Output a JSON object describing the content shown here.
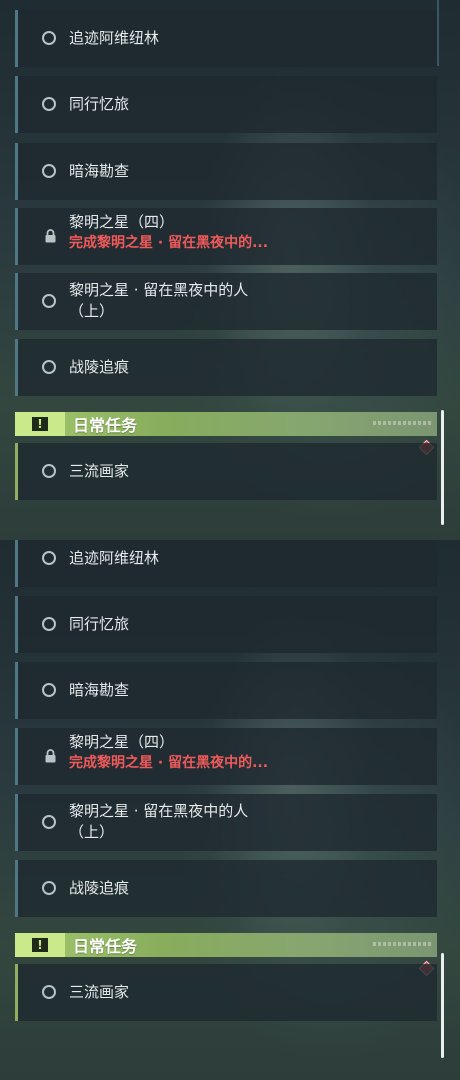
{
  "quests": [
    {
      "title": "追迹阿维纽林",
      "status": "available"
    },
    {
      "title": "同行忆旅",
      "status": "available"
    },
    {
      "title": "暗海勘查",
      "status": "available"
    },
    {
      "title": "黎明之星（四）",
      "status": "locked",
      "requirement": "完成黎明之星 · 留在黑夜中的..."
    },
    {
      "title_line1": "黎明之星 · 留在黑夜中的人",
      "title_line2": "（上）",
      "status": "available"
    },
    {
      "title": "战陵追痕",
      "status": "available"
    }
  ],
  "daily": {
    "header": "日常任务",
    "items": [
      {
        "title": "三流画家",
        "status": "available"
      }
    ]
  },
  "colors": {
    "accent_green": "#a3c86e",
    "requirement_red": "#f15a5a",
    "row_border": "#4e7886",
    "badge_red": "#d8424f"
  },
  "icons": [
    "circle-status-icon",
    "lock-icon",
    "alert-icon",
    "diamond-badge-icon"
  ]
}
